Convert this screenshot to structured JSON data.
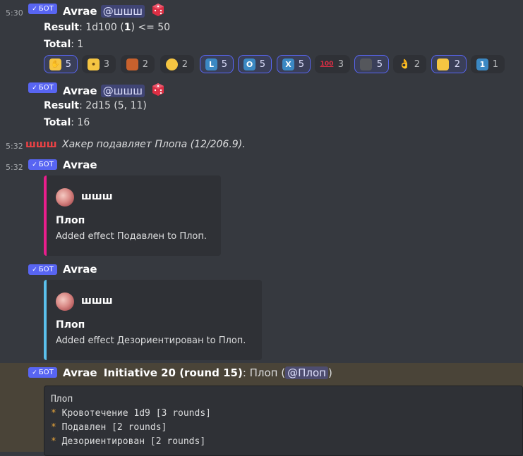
{
  "messages": {
    "m1": {
      "time": "5:30",
      "badge": "БОТ",
      "author": "Avrae",
      "mention": "@шшш",
      "result_label": "Result",
      "result_value": ": 1d100 (",
      "result_bold": "1",
      "result_tail": ") <= 50",
      "total_label": "Total",
      "total_value": ": 1",
      "reactions": [
        {
          "icon": "hand-emoji",
          "count": "5",
          "me": true
        },
        {
          "icon": "shush-face-emoji",
          "count": "3",
          "me": false
        },
        {
          "icon": "brick-emoji",
          "count": "2",
          "me": false
        },
        {
          "icon": "flushed-face-emoji",
          "count": "2",
          "me": false
        },
        {
          "icon": "letter-l-emoji",
          "glyph": "L",
          "count": "5",
          "me": true
        },
        {
          "icon": "letter-o-emoji",
          "glyph": "O",
          "count": "5",
          "me": true
        },
        {
          "icon": "letter-x-emoji",
          "glyph": "X",
          "count": "5",
          "me": true
        },
        {
          "icon": "hundred-emoji",
          "glyph": "100",
          "count": "3",
          "me": false
        },
        {
          "icon": "portrait-emoji",
          "count": "5",
          "me": true
        },
        {
          "icon": "ok-hand-emoji",
          "count": "2",
          "me": false
        },
        {
          "icon": "cheese-emoji",
          "count": "2",
          "me": true
        },
        {
          "icon": "number-one-emoji",
          "glyph": "1",
          "count": "1",
          "me": false
        }
      ]
    },
    "m2": {
      "badge": "БОТ",
      "author": "Avrae",
      "mention": "@шшш",
      "result_label": "Result",
      "result_value": ": 2d15 (5, 11)",
      "total_label": "Total",
      "total_value": ": 16"
    },
    "m3": {
      "time": "5:32",
      "author": "шшш",
      "text": "Хакер подавляет Плопа (12/206.9)."
    },
    "m4": {
      "time": "5:32",
      "badge": "БОТ",
      "author": "Avrae",
      "embed_color": "#e91e8c",
      "embed_author": "шшш",
      "embed_title": "Плоп",
      "embed_desc": "Added effect Подавлен to Плоп."
    },
    "m5": {
      "badge": "БОТ",
      "author": "Avrae",
      "embed_color": "#5bc0eb",
      "embed_author": "шшш",
      "embed_title": "Плоп",
      "embed_desc": "Added effect Дезориентирован to Плоп."
    },
    "m6": {
      "badge": "БОТ",
      "author": "Avrae",
      "init_label": "Initiative 20 (round 15)",
      "after": ": Плоп (",
      "mention": "@Плоп",
      "close": ")",
      "code_lines": [
        {
          "star": "",
          "text": "Плоп"
        },
        {
          "star": "*",
          "text": " Кровотечение 1d9 [3 rounds]"
        },
        {
          "star": "*",
          "text": " Подавлен [2 rounds]"
        },
        {
          "star": "*",
          "text": " Дезориентирован [2 rounds]"
        }
      ]
    }
  }
}
